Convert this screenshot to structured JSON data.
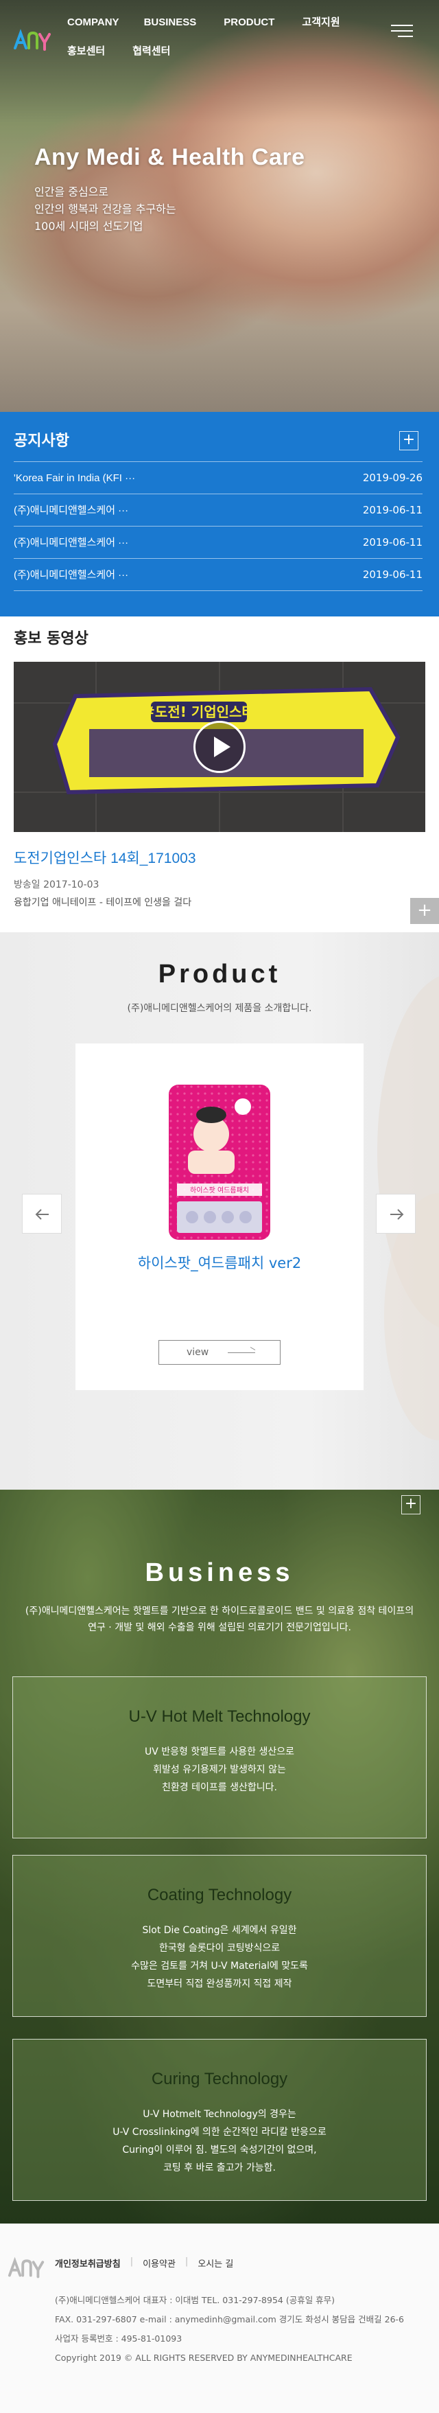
{
  "header": {
    "nav": [
      "COMPANY",
      "BUSINESS",
      "PRODUCT",
      "고객지원",
      "홍보센터",
      "협력센터"
    ]
  },
  "hero": {
    "title": "Any Medi & Health Care",
    "lines": [
      "인간을 중심으로",
      "인간의 행복과 건강을 추구하는",
      "100세 시대의 선도기업"
    ]
  },
  "notice": {
    "title": "공지사항",
    "more": "+",
    "items": [
      {
        "title": "'Korea Fair in India (KFI ···",
        "date": "2019-09-26"
      },
      {
        "title": "(주)애니메디앤헬스케어 ···",
        "date": "2019-06-11"
      },
      {
        "title": "(주)애니메디앤헬스케어 ···",
        "date": "2019-06-11"
      },
      {
        "title": "(주)애니메디앤헬스케어 ···",
        "date": "2019-06-11"
      }
    ]
  },
  "promo": {
    "title": "홍보 동영상",
    "video_caption": "#도전! 기업인스타",
    "video_title": "도전기업인스타 14회_171003",
    "date": "방송일 2017-10-03",
    "desc": "융합기업 애니테이프 - 테이프에 인생을 걸다",
    "more": "+"
  },
  "product": {
    "title": "Product",
    "subtitle": "(주)애니메디앤헬스케어의 제품을 소개합니다.",
    "item_name": "하이스팟_여드름패치 ver2",
    "pack_label": "하이스팟 여드름패치",
    "view_label": "view"
  },
  "business": {
    "title": "Business",
    "desc": [
      "(주)애니메디앤헬스케어는 핫멜트를 기반으로 한 하이드로콜로이드 밴드 및 의료용 점착 테이프의",
      "연구 · 개발 및 해외 수출을 위해 설립된 의료기기 전문기업입니다."
    ],
    "more": "+",
    "boxes": [
      {
        "title": "U-V Hot Melt Technology",
        "lines": [
          "UV 반응형 핫멜트를 사용한 생산으로",
          "휘발성 유기용제가 발생하지 않는",
          "친환경 테이프를 생산합니다."
        ]
      },
      {
        "title": "Coating Technology",
        "lines": [
          "Slot Die Coating은 세계에서 유일한",
          "한국형 슬롯다이 코팅방식으로",
          "수많은 검토를 거쳐 U-V Material에 맞도록",
          "도면부터 직접 완성품까지 직접 제작"
        ]
      },
      {
        "title": "Curing Technology",
        "lines": [
          "U-V Hotmelt Technology의 경우는",
          "U-V Crosslinking에 의한 순간적인 라디칼 반응으로",
          "Curing이 이루어 짐. 별도의 숙성기간이 없으며,",
          "코팅 후 바로 출고가 가능함."
        ]
      }
    ]
  },
  "footer": {
    "links": [
      "개인정보취급방침",
      "이용약관",
      "오시는 길"
    ],
    "info": [
      "(주)애니메디앤헬스케어   대표자 : 이대범   TEL. 031-297-8954 (공휴일 휴무)",
      "FAX. 031-297-6807   e-mail : anymedinh@gmail.com   경기도 화성시 봉담읍 건배길 26-6",
      "사업자 등록번호 : 495-81-01093",
      "Copyright 2019 © ALL RIGHTS RESERVED BY ANYMEDINHEALTHCARE"
    ]
  },
  "colors": {
    "accent": "#1a79d0",
    "footer_bg": "#fafafa",
    "product_bg": "#efefef"
  }
}
